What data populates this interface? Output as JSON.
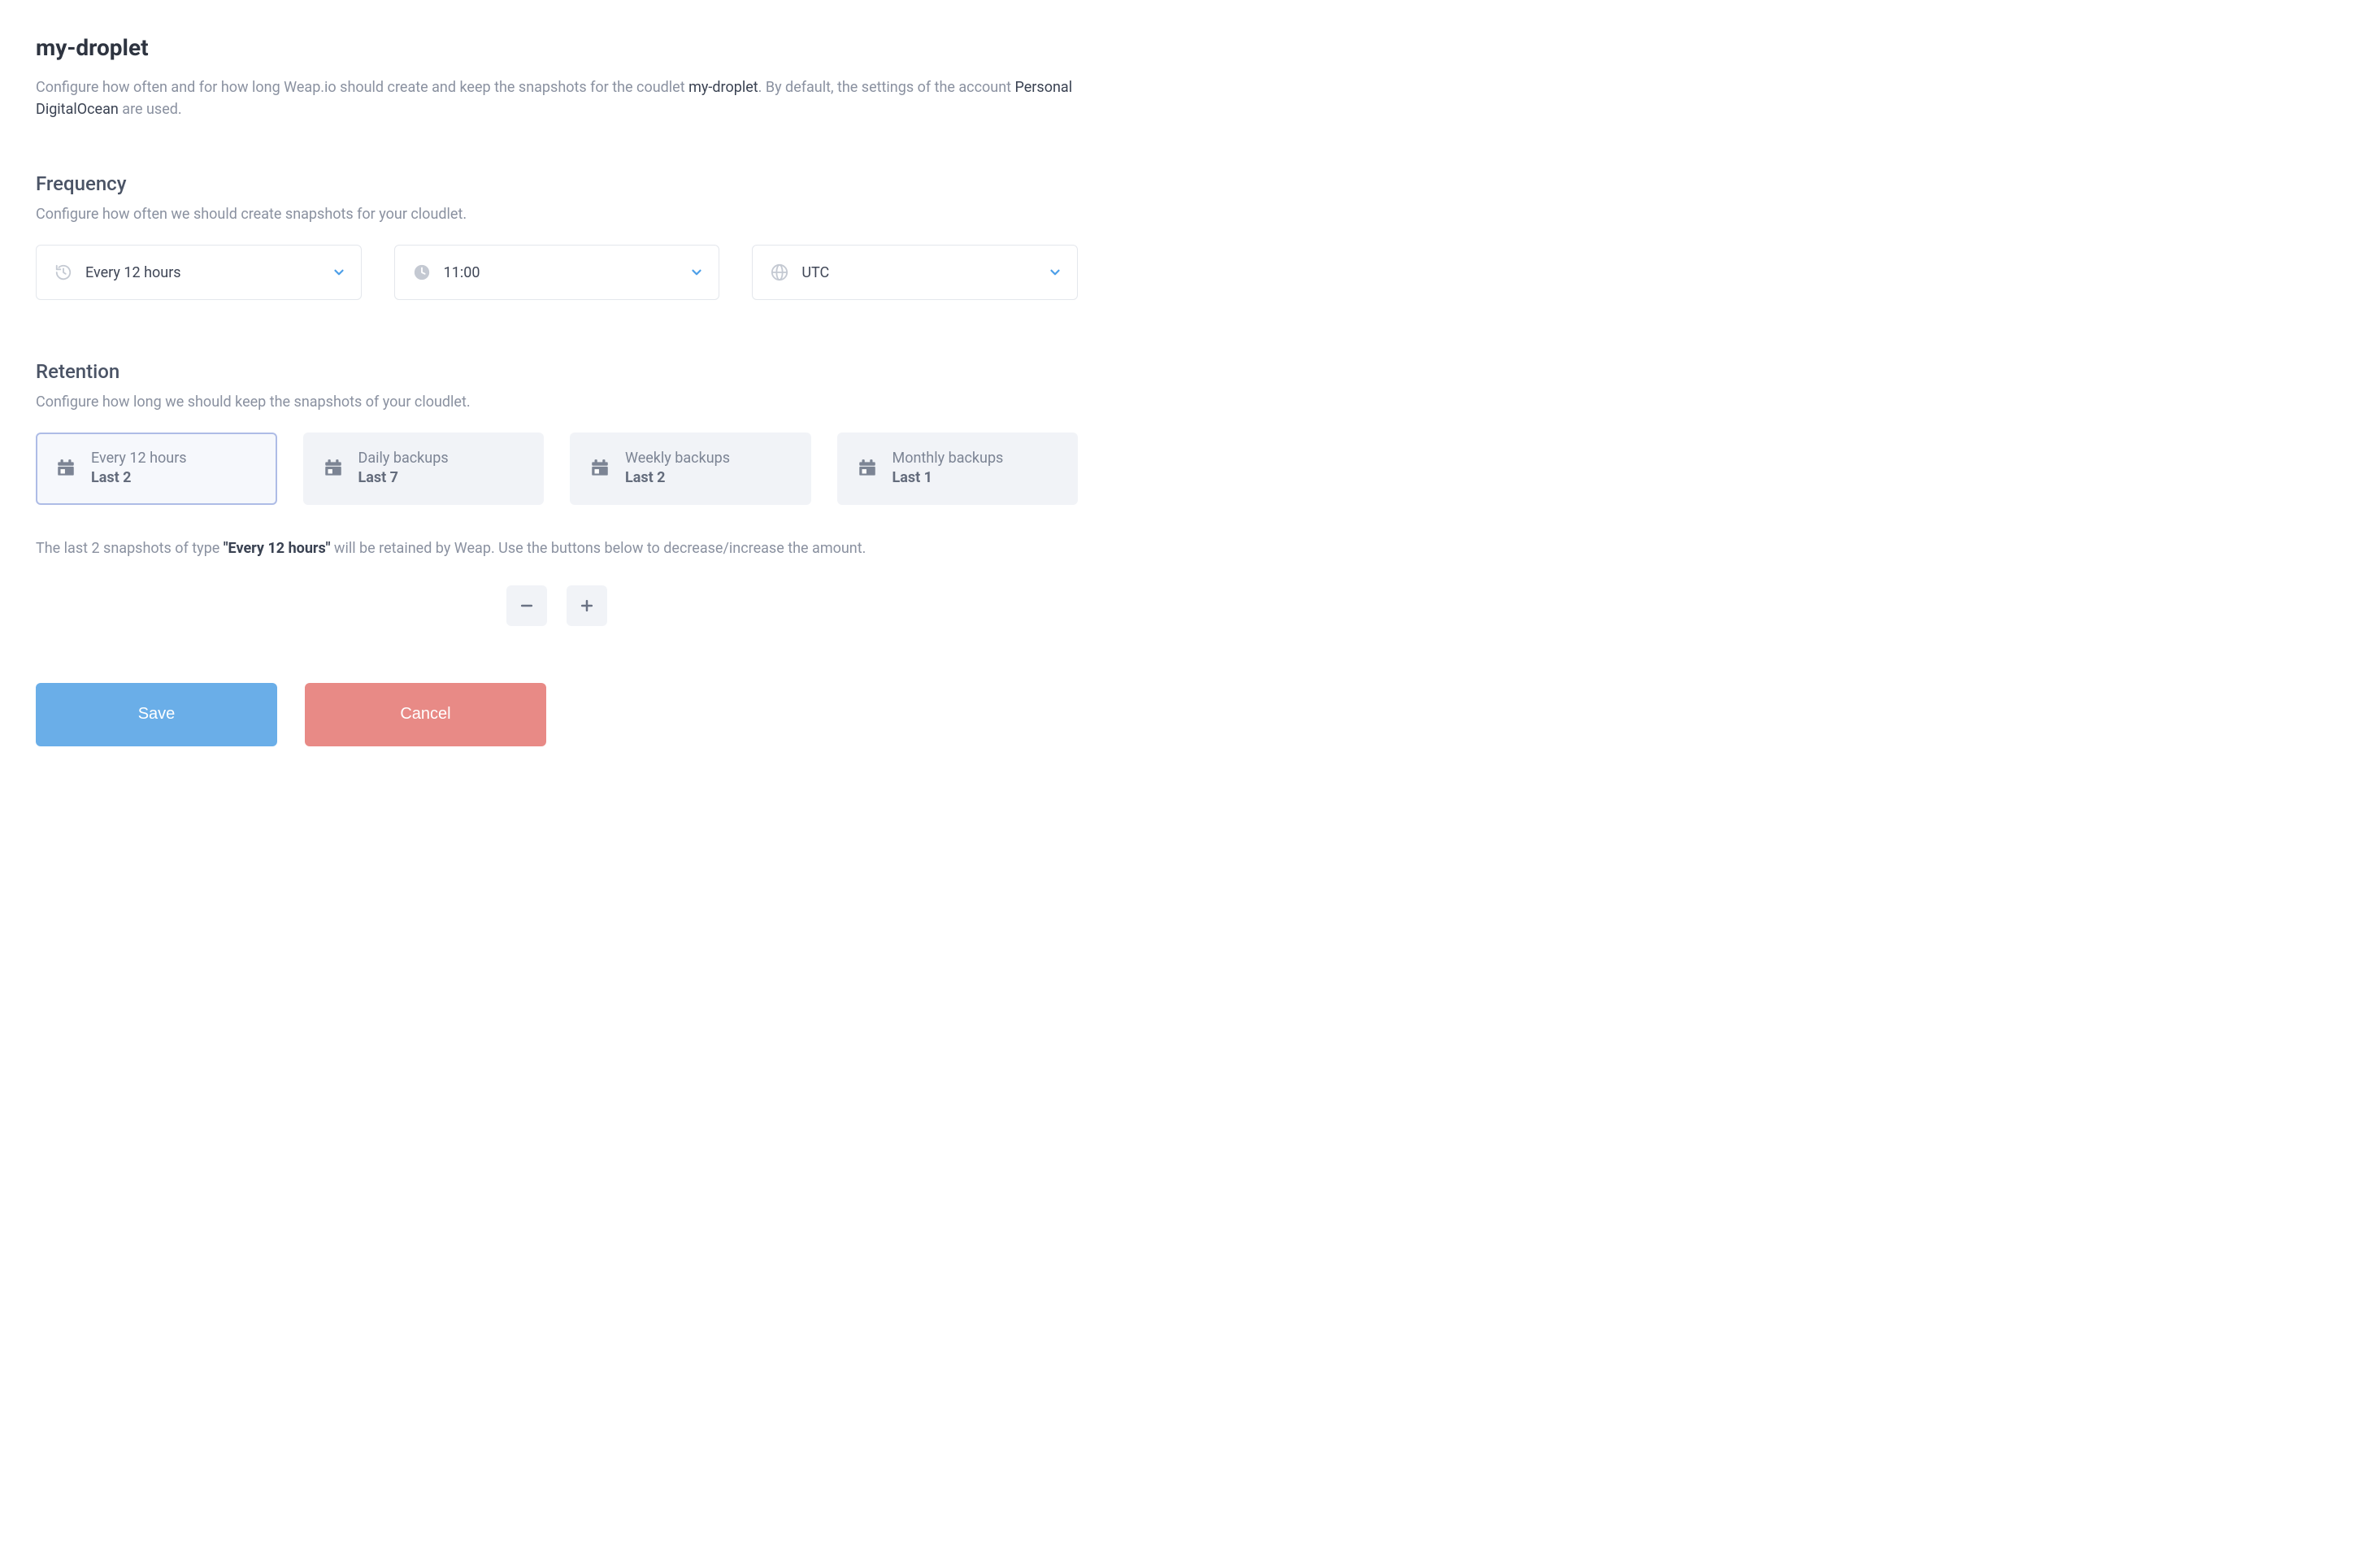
{
  "title": "my-droplet",
  "intro": {
    "pre": "Configure how often and for how long Weap.io should create and keep the snapshots for the coudlet ",
    "cloudlet": "my-droplet",
    "mid": ". By default, the settings of the account ",
    "account": "Personal DigitalOcean",
    "post": " are used."
  },
  "frequency": {
    "heading": "Frequency",
    "desc": "Configure how often we should create snapshots for your cloudlet.",
    "interval": "Every 12 hours",
    "time": "11:00",
    "timezone": "UTC"
  },
  "retention": {
    "heading": "Retention",
    "desc": "Configure how long we should keep the snapshots of your cloudlet.",
    "cards": [
      {
        "label": "Every 12 hours",
        "value": "Last 2",
        "selected": true
      },
      {
        "label": "Daily backups",
        "value": "Last 7",
        "selected": false
      },
      {
        "label": "Weekly backups",
        "value": "Last 2",
        "selected": false
      },
      {
        "label": "Monthly backups",
        "value": "Last 1",
        "selected": false
      }
    ],
    "note": {
      "pre": "The last 2 snapshots of type ",
      "type": "\"Every 12 hours\"",
      "post": " will be retained by Weap. Use the buttons below to decrease/increase the amount."
    }
  },
  "actions": {
    "save": "Save",
    "cancel": "Cancel"
  }
}
